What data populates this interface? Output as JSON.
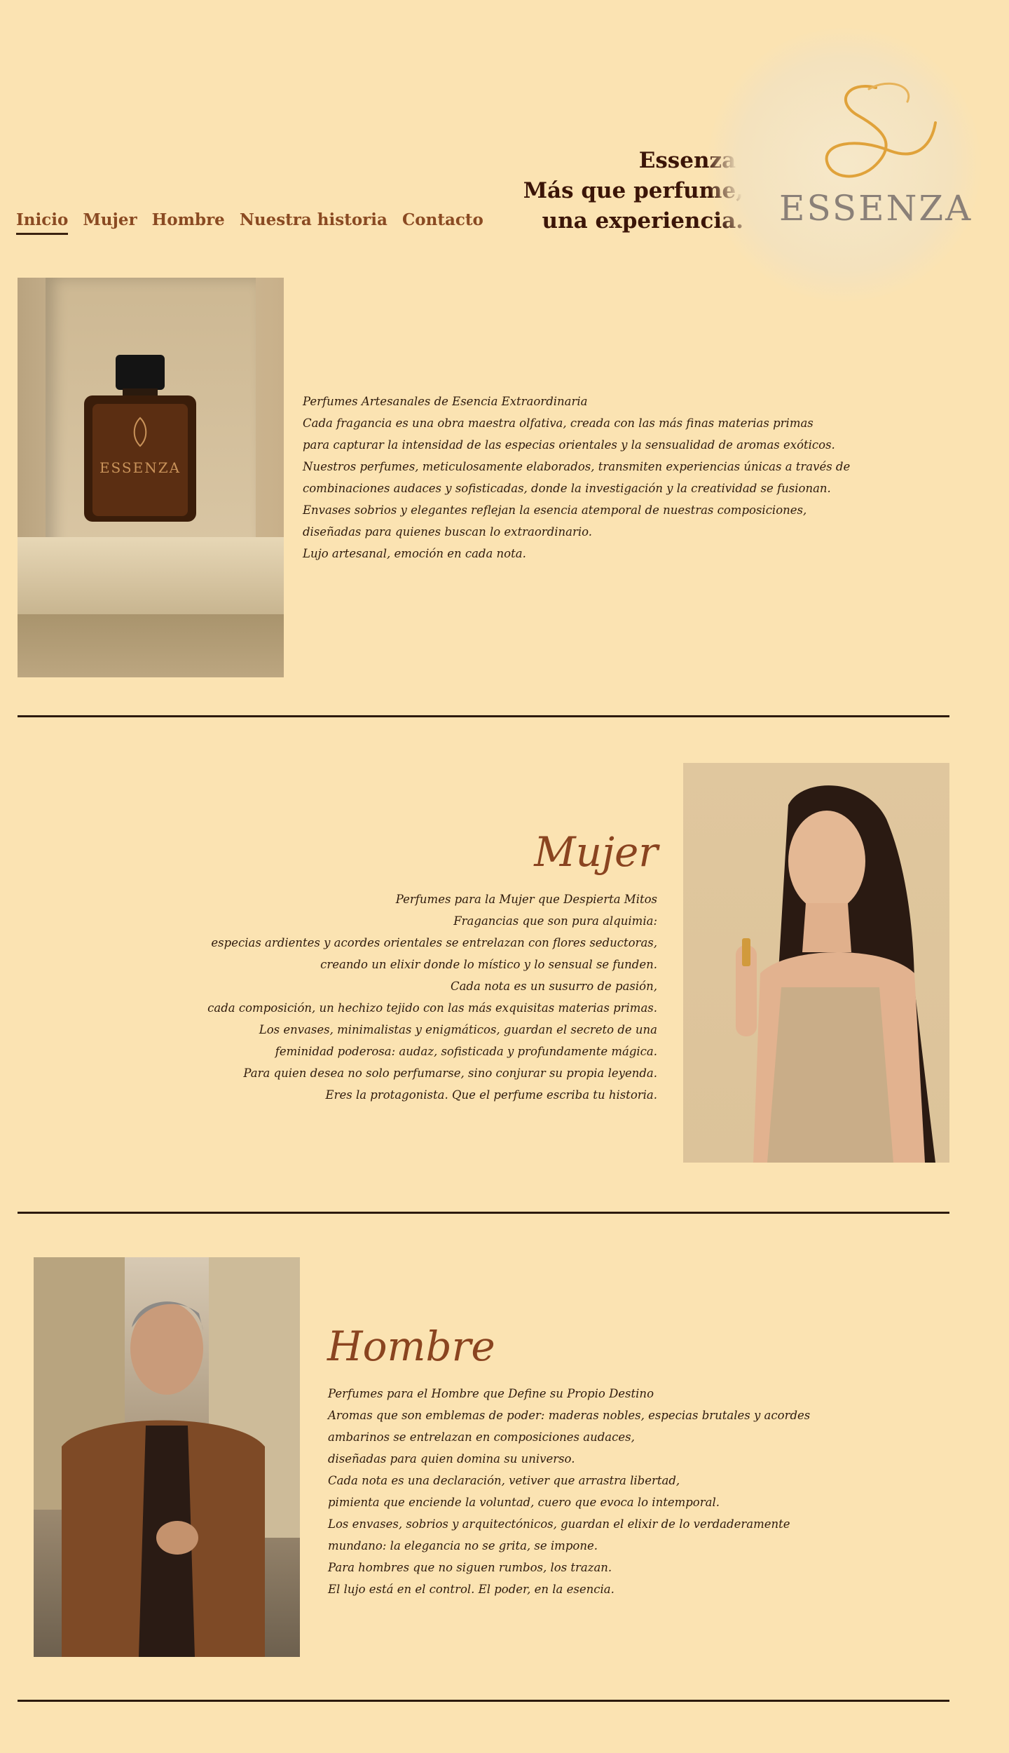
{
  "nav": {
    "items": [
      {
        "label": "Inicio",
        "active": true
      },
      {
        "label": "Mujer"
      },
      {
        "label": "Hombre"
      },
      {
        "label": "Nuestra historia"
      },
      {
        "label": "Contacto"
      }
    ]
  },
  "header": {
    "tagline": [
      "Essenza.",
      "Más que perfume,",
      "una experiencia."
    ],
    "logo_text": "ESSENZA"
  },
  "intro": {
    "image_label": "ESSENZA",
    "lines": [
      "Perfumes Artesanales de Esencia Extraordinaria",
      "Cada fragancia es una obra maestra olfativa, creada con las más finas  materias primas",
      "para capturar la intensidad de las especias orientales y la sensualidad de aromas exóticos.",
      "Nuestros perfumes, meticulosamente  elaborados, transmiten experiencias únicas a través de",
      "combinaciones  audaces y sofisticadas, donde la investigación y la creatividad se  fusionan.",
      "Envases sobrios y elegantes reflejan la esencia atemporal de  nuestras composiciones,",
      "diseñadas para quienes buscan lo extraordinario.",
      "Lujo artesanal, emoción en cada nota."
    ]
  },
  "mujer": {
    "title": "Mujer",
    "lines": [
      "Perfumes para la Mujer que Despierta Mitos",
      "Fragancias que son pura alquimia:",
      "especias ardientes y acordes  orientales se entrelazan con flores seductoras,",
      "creando un elixir donde  lo místico y lo sensual se funden.",
      "Cada nota es un susurro de pasión,",
      "cada composición, un hechizo tejido con las más exquisitas materias  primas.",
      "Los envases, minimalistas y enigmáticos, guardan el secreto de  una",
      "feminidad poderosa: audaz, sofisticada y profundamente mágica.",
      "Para quien desea no solo perfumarse, sino conjurar su propia leyenda.",
      "Eres la protagonista. Que el perfume escriba tu historia."
    ]
  },
  "hombre": {
    "title": "Hombre",
    "lines": [
      "Perfumes para el Hombre que Define su Propio Destino",
      "Aromas que son emblemas de poder: maderas nobles, especias brutales y  acordes",
      "ambarinos se entrelazan en composiciones audaces,",
      "diseñadas para quien domina su universo.",
      "Cada nota es una declaración, vetiver que  arrastra libertad,",
      "pimienta que enciende la voluntad, cuero que evoca lo intemporal.",
      "Los envases, sobrios y arquitectónicos, guardan el elixir  de lo verdaderamente",
      "mundano: la elegancia no se grita, se impone.",
      "Para hombres que no siguen rumbos, los trazan.",
      "El lujo está en el control. El poder, en la esencia."
    ]
  },
  "colors": {
    "background": "#fbe3b2",
    "accent": "#8a4420",
    "text": "#2e1a0c",
    "rule": "#2c1a0e"
  }
}
